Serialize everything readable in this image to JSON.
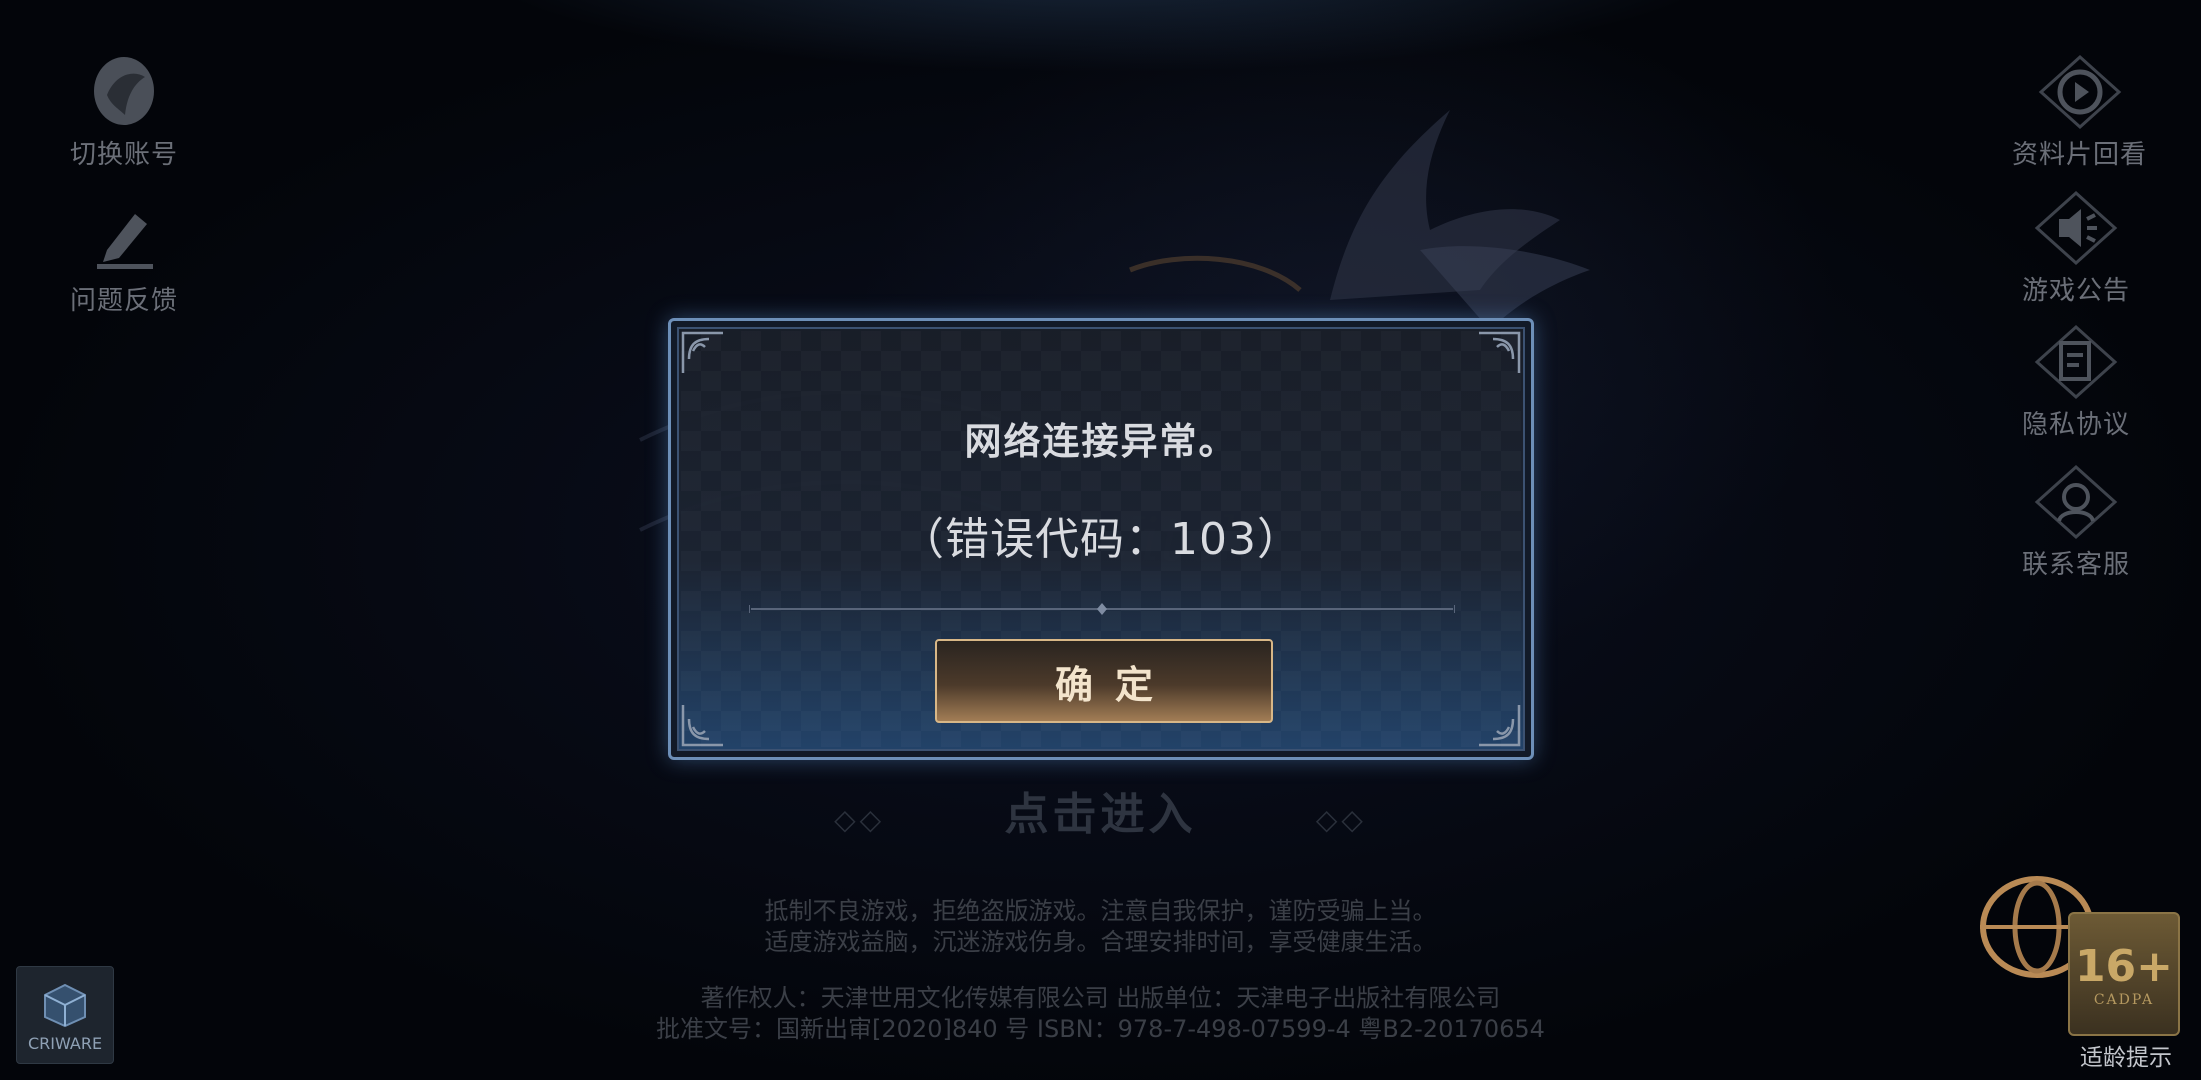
{
  "left_menu": [
    {
      "label": "切换账号",
      "icon": "switch-account-icon"
    },
    {
      "label": "问题反馈",
      "icon": "feedback-pen-icon"
    }
  ],
  "right_menu": [
    {
      "label": "资料片回看",
      "icon": "replay-icon"
    },
    {
      "label": "游戏公告",
      "icon": "announcement-icon"
    },
    {
      "label": "隐私协议",
      "icon": "privacy-document-icon"
    },
    {
      "label": "联系客服",
      "icon": "customer-service-icon"
    }
  ],
  "dialog": {
    "title": "网络连接异常。",
    "error_code": "（错误代码：103）",
    "confirm_label": "确定"
  },
  "enter_hint": "点击进入",
  "health_notice": [
    "抵制不良游戏，拒绝盗版游戏。注意自我保护，谨防受骗上当。",
    "适度游戏益脑，沉迷游戏伤身。合理安排时间，享受健康生活。"
  ],
  "copyright": [
    "著作权人：天津世用文化传媒有限公司   出版单位：天津电子出版社有限公司",
    "批准文号：国新出审[2020]840 号   ISBN：978-7-498-07599-4   粤B2-20170654"
  ],
  "criware_label": "CRIWARE",
  "age_rating": {
    "number": "16+",
    "org": "CADPA",
    "tip": "适龄提示"
  },
  "colors": {
    "dialog_border": "#6d8fb8",
    "button_gold": "#d8b787",
    "menu_text": "#6b6f78"
  }
}
